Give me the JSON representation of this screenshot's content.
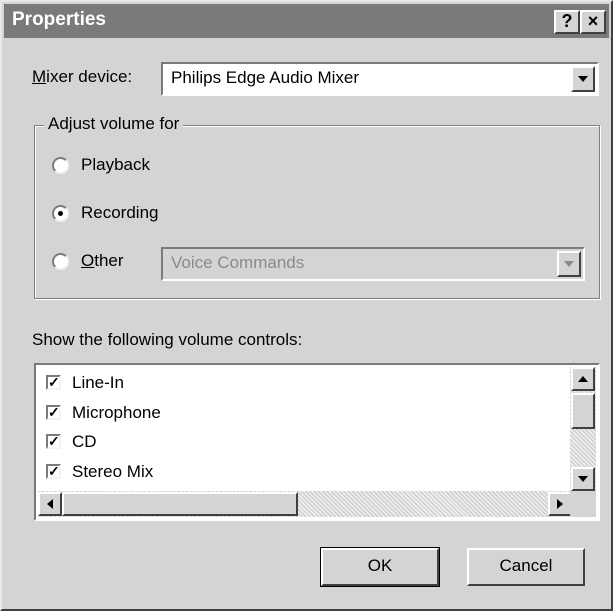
{
  "window": {
    "title": "Properties",
    "help_label": "?",
    "close_label": "×"
  },
  "mixer": {
    "label_first": "M",
    "label_rest": "ixer device:",
    "selected": "Philips Edge Audio Mixer"
  },
  "adjust_group": {
    "legend": "Adjust volume for",
    "options": [
      {
        "label": "Playback",
        "checked": false
      },
      {
        "label": "Recording",
        "checked": true
      },
      {
        "label_first": "O",
        "label_rest": "ther",
        "checked": false
      }
    ],
    "other_select": "Voice Commands"
  },
  "controls": {
    "heading": "Show the following volume controls:",
    "items": [
      {
        "label": "Line-In",
        "checked": true
      },
      {
        "label": "Microphone",
        "checked": true
      },
      {
        "label": "CD",
        "checked": true
      },
      {
        "label": "Stereo Mix",
        "checked": true
      }
    ]
  },
  "buttons": {
    "ok": "OK",
    "cancel": "Cancel"
  }
}
